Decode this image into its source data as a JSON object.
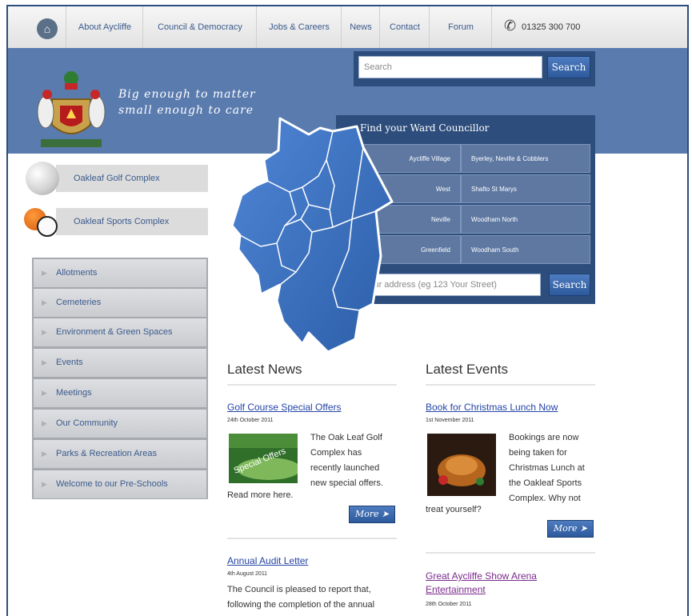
{
  "nav": {
    "items": [
      "About Aycliffe",
      "Council & Democracy",
      "Jobs & Careers",
      "News",
      "Contact",
      "Forum"
    ],
    "phone": "01325 300 700"
  },
  "banner": {
    "tagline_1": "Big enough to matter",
    "tagline_2": "small enough to care"
  },
  "search": {
    "placeholder": "Search",
    "button": "Search"
  },
  "ward": {
    "title": "Find your Ward Councillor",
    "wards": [
      [
        "Aycliffe Village",
        "Byerley, Neville & Cobblers"
      ],
      [
        "West",
        "Shafto St Marys"
      ],
      [
        "Neville",
        "Woodham North"
      ],
      [
        "Greenfield",
        "Woodham South"
      ]
    ],
    "address_placeholder": "Your address (eg 123 Your Street)",
    "address_button": "Search"
  },
  "promos": [
    "Oakleaf Golf Complex",
    "Oakleaf Sports Complex"
  ],
  "menu": [
    "Allotments",
    "Cemeteries",
    "Environment & Green Spaces",
    "Events",
    "Meetings",
    "Our Community",
    "Parks & Recreation Areas",
    "Welcome to our Pre-Schools"
  ],
  "news": {
    "title": "Latest News",
    "items": [
      {
        "headline": "Golf Course Special Offers",
        "date": "24th October 2011",
        "lines": [
          "The Oak Leaf Golf",
          "Complex has",
          "recently launched",
          "new special offers."
        ],
        "tail": "Read more here.",
        "thumb_text": "Special Offers"
      },
      {
        "headline": "Annual Audit Letter",
        "date": "4th August 2011",
        "lines": [
          "The Council is pleased to report that,",
          "following the completion of the annual"
        ]
      }
    ],
    "more": "More"
  },
  "events": {
    "title": "Latest Events",
    "items": [
      {
        "headline": "Book for Christmas Lunch Now",
        "date": "1st November 2011",
        "lines": [
          "Bookings are now",
          "being taken for",
          "Christmas Lunch at",
          "the Oakleaf Sports",
          "Complex. Why not"
        ],
        "tail": "treat yourself?"
      },
      {
        "headline_1": "Great Aycliffe Show Arena",
        "headline_2": "Entertainment",
        "date": "28th October 2011"
      }
    ],
    "more": "More"
  }
}
